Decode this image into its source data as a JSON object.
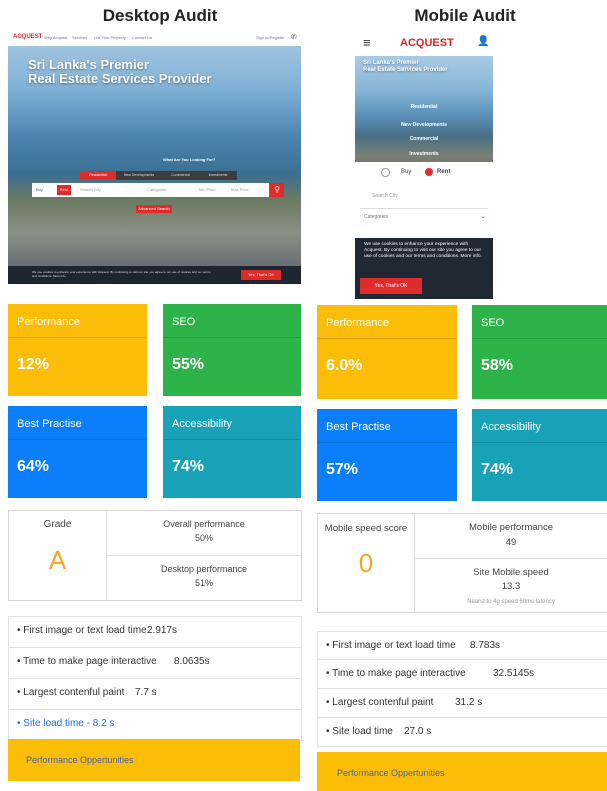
{
  "desktop": {
    "title": "Desktop Audit",
    "screenshot": {
      "logo": "ACQUEST",
      "nav": [
        "Why Acquest",
        "Services",
        "List Your Property",
        "Contact Us"
      ],
      "login": "Sign In/Register",
      "hero_line1": "Sri Lanka's Premier",
      "hero_line2": "Real Estate Services Provider",
      "search_question": "What Are You Looking For?",
      "tabs": [
        "Residential",
        "New Developments",
        "Commercial",
        "Investments"
      ],
      "buy": "Buy",
      "rent": "Rent",
      "search_placeholder": "Search City",
      "categories": "Categories",
      "min_price": "Min Price",
      "max_price": "Max Price",
      "advanced": "Advanced Search",
      "cookie_text": "We use cookies to enhance your experience with Acquest. By continuing to visit our site you agree to our use of cookies and our terms and conditions. More info.",
      "cookie_btn": "Yes, That's OK"
    },
    "cards": {
      "performance": {
        "label": "Performance",
        "value": "12%"
      },
      "seo": {
        "label": "SEO",
        "value": "55%"
      },
      "best_practise": {
        "label": "Best Practise",
        "value": "64%"
      },
      "accessibility": {
        "label": "Accessibility",
        "value": "74%"
      }
    },
    "grade": {
      "label": "Grade",
      "value": "A",
      "overall_label": "Overall performance",
      "overall_value": "50%",
      "desktop_label": "Desktop performance",
      "desktop_value": "51%"
    },
    "metrics": {
      "first_load": {
        "label": "• First image or text load time",
        "value": "2.917s"
      },
      "interactive": {
        "label": "• Time to make page interactive",
        "value": "8.0635s"
      },
      "lcp": {
        "label": "• Largest contenful paint",
        "value": "7.7 s"
      },
      "site_load": "• Site load time - 8.2 s"
    },
    "opportunities": "Performance Oppertunities"
  },
  "mobile": {
    "title": "Mobile Audit",
    "screenshot": {
      "logo": "ACQUEST",
      "hero_line1": "Sri Lanka's Premier",
      "hero_line2": "Real Estate Services Provider",
      "menu": [
        "Residential",
        "New Developments",
        "Commercial",
        "Investments"
      ],
      "buy": "Buy",
      "rent": "Rent",
      "search_placeholder": "Search City",
      "categories": "Categories",
      "cookie_text": "We use cookies to enhance your experience with Acquest. By continuing to visit our site you agree to our use of cookies and our terms and conditions. More info.",
      "cookie_btn": "Yes, That's OK"
    },
    "cards": {
      "performance": {
        "label": "Performance",
        "value": "6.0%"
      },
      "seo": {
        "label": "SEO",
        "value": "58%"
      },
      "best_practise": {
        "label": "Best Practise",
        "value": "57%"
      },
      "accessibility": {
        "label": "Accessibility",
        "value": "74%"
      }
    },
    "speed": {
      "label": "Mobile speed score",
      "value": "0",
      "perf_label": "Mobile performance",
      "perf_value": "49",
      "site_label": "Site Mobile speed",
      "site_value": "13.3",
      "note": "Nearst to 4g speed 60ms latency"
    },
    "metrics": {
      "first_load": {
        "label": "• First image or text load time",
        "value": "8.783s"
      },
      "interactive": {
        "label": "• Time to make page interactive",
        "value": "32.5145s"
      },
      "lcp": {
        "label": "• Largest contenful paint",
        "value": "31.2 s"
      },
      "site_load": {
        "label": "• Site load time",
        "value": "27.0 s"
      }
    },
    "opportunities": "Performance Oppertunities"
  },
  "colors": {
    "yellow": "#fbbd08",
    "green": "#2db34a",
    "blue": "#0b7ffb",
    "teal": "#17a2b8",
    "grade_orange": "#f5a623",
    "brand_red": "#e0242a"
  }
}
